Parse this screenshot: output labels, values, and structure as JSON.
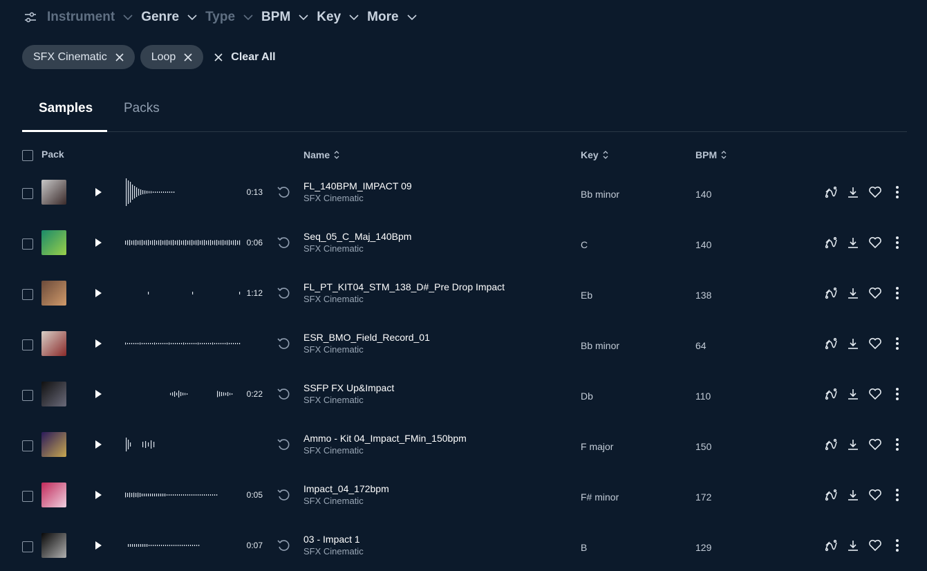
{
  "filters": [
    {
      "label": "Instrument",
      "dim": true
    },
    {
      "label": "Genre",
      "dim": false
    },
    {
      "label": "Type",
      "dim": true
    },
    {
      "label": "BPM",
      "dim": false
    },
    {
      "label": "Key",
      "dim": false
    },
    {
      "label": "More",
      "dim": false
    }
  ],
  "chips": [
    {
      "label": "SFX Cinematic"
    },
    {
      "label": "Loop"
    }
  ],
  "clear_all_label": "Clear All",
  "tabs": [
    {
      "label": "Samples",
      "active": true
    },
    {
      "label": "Packs",
      "active": false
    }
  ],
  "table_header": {
    "pack": "Pack",
    "name": "Name",
    "key": "Key",
    "bpm": "BPM"
  },
  "rows": [
    {
      "name": "FL_140BPM_IMPACT 09",
      "category": "SFX Cinematic",
      "key": "Bb minor",
      "bpm": "140",
      "duration": "0:13",
      "art_colors": [
        "#c8c8c8",
        "#3a2a2a"
      ]
    },
    {
      "name": "Seq_05_C_Maj_140Bpm",
      "category": "SFX Cinematic",
      "key": "C",
      "bpm": "140",
      "duration": "0:06",
      "art_colors": [
        "#1a8a6a",
        "#9ad04a"
      ]
    },
    {
      "name": "FL_PT_KIT04_STM_138_D#_Pre Drop Impact",
      "category": "SFX Cinematic",
      "key": "Eb",
      "bpm": "138",
      "duration": "1:12",
      "art_colors": [
        "#6b4a3a",
        "#d09a6a"
      ]
    },
    {
      "name": "ESR_BMO_Field_Record_01",
      "category": "SFX Cinematic",
      "key": "Bb minor",
      "bpm": "64",
      "duration": "",
      "art_colors": [
        "#d8d0c8",
        "#8a2a2a"
      ]
    },
    {
      "name": "SSFP FX Up&Impact",
      "category": "SFX Cinematic",
      "key": "Db",
      "bpm": "110",
      "duration": "0:22",
      "art_colors": [
        "#101010",
        "#6a6a7a"
      ]
    },
    {
      "name": "Ammo - Kit 04_Impact_FMin_150bpm",
      "category": "SFX Cinematic",
      "key": "F major",
      "bpm": "150",
      "duration": "",
      "art_colors": [
        "#2a1a5a",
        "#c8a850"
      ]
    },
    {
      "name": "Impact_04_172bpm",
      "category": "SFX Cinematic",
      "key": "F# minor",
      "bpm": "172",
      "duration": "0:05",
      "art_colors": [
        "#c02a5a",
        "#f0d0e0"
      ]
    },
    {
      "name": "03 - Impact 1",
      "category": "SFX Cinematic",
      "key": "B",
      "bpm": "129",
      "duration": "0:07",
      "art_colors": [
        "#080808",
        "#b0b0b0"
      ]
    }
  ],
  "icons": {
    "filter": "sliders-icon",
    "chevron": "chevron-down-icon",
    "close": "close-icon",
    "play": "play-icon",
    "revert": "rotate-left-icon",
    "similar": "similar-sounds-icon",
    "download": "download-icon",
    "like": "heart-icon",
    "more": "more-vertical-icon"
  }
}
